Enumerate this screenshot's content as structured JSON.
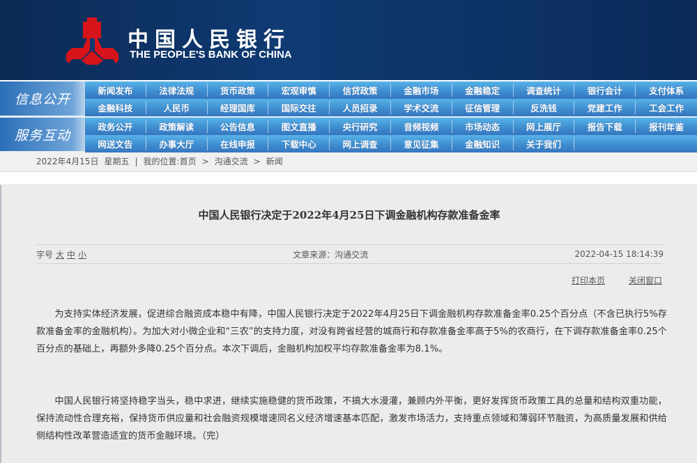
{
  "header": {
    "logo_cn": "中国人民银行",
    "logo_en": "THE PEOPLE'S BANK OF CHINA",
    "brand_red": "#d7141a"
  },
  "nav": [
    {
      "label": "信息公开",
      "rows": [
        [
          "新闻发布",
          "法律法规",
          "货币政策",
          "宏观审慎",
          "信贷政策",
          "金融市场",
          "金融稳定",
          "调查统计",
          "银行会计",
          "支付体系"
        ],
        [
          "金融科技",
          "人民币",
          "经理国库",
          "国际交往",
          "人员招录",
          "学术交流",
          "征信管理",
          "反洗钱",
          "党建工作",
          "工会工作"
        ]
      ]
    },
    {
      "label": "服务互动",
      "rows": [
        [
          "政务公开",
          "政策解读",
          "公告信息",
          "图文直播",
          "央行研究",
          "音频视频",
          "市场动态",
          "网上展厅",
          "报告下载",
          "报刊年鉴"
        ],
        [
          "网送文告",
          "办事大厅",
          "在线申报",
          "下载中心",
          "网上调查",
          "意见征集",
          "金融知识",
          "关于我们"
        ]
      ]
    }
  ],
  "breadcrumb": {
    "date": "2022年4月15日",
    "weekday": "星期五",
    "sep": "|",
    "location_label": "我的位置:",
    "items": [
      "首页",
      "沟通交流",
      "新闻"
    ],
    "arrow": ">"
  },
  "article": {
    "title": "中国人民银行决定于2022年4月25日下调金融机构存款准备金率",
    "font_label": "字号",
    "font_sizes": [
      "大",
      "中",
      "小"
    ],
    "source": "文章来源：沟通交流",
    "datetime": "2022-04-15 18:14:39",
    "print": "打印本页",
    "close": "关闭窗口",
    "paragraphs": [
      "为支持实体经济发展，促进综合融资成本稳中有降，中国人民银行决定于2022年4月25日下调金融机构存款准备金率0.25个百分点（不含已执行5%存款准备金率的金融机构）。为加大对小微企业和“三农”的支持力度，对没有跨省经营的城商行和存款准备金率高于5%的农商行，在下调存款准备金率0.25个百分点的基础上，再额外多降0.25个百分点。本次下调后，金融机构加权平均存款准备金率为8.1%。",
      "中国人民银行将坚持稳字当头，稳中求进，继续实施稳健的货币政策，不搞大水漫灌，兼顾内外平衡，更好发挥货币政策工具的总量和结构双重功能，保持流动性合理充裕，保持货币供应量和社会融资规模增速同名义经济增速基本匹配，激发市场活力，支持重点领域和薄弱环节融资，为高质量发展和供给侧结构性改革营造适宜的货币金融环境。（完）"
    ]
  }
}
